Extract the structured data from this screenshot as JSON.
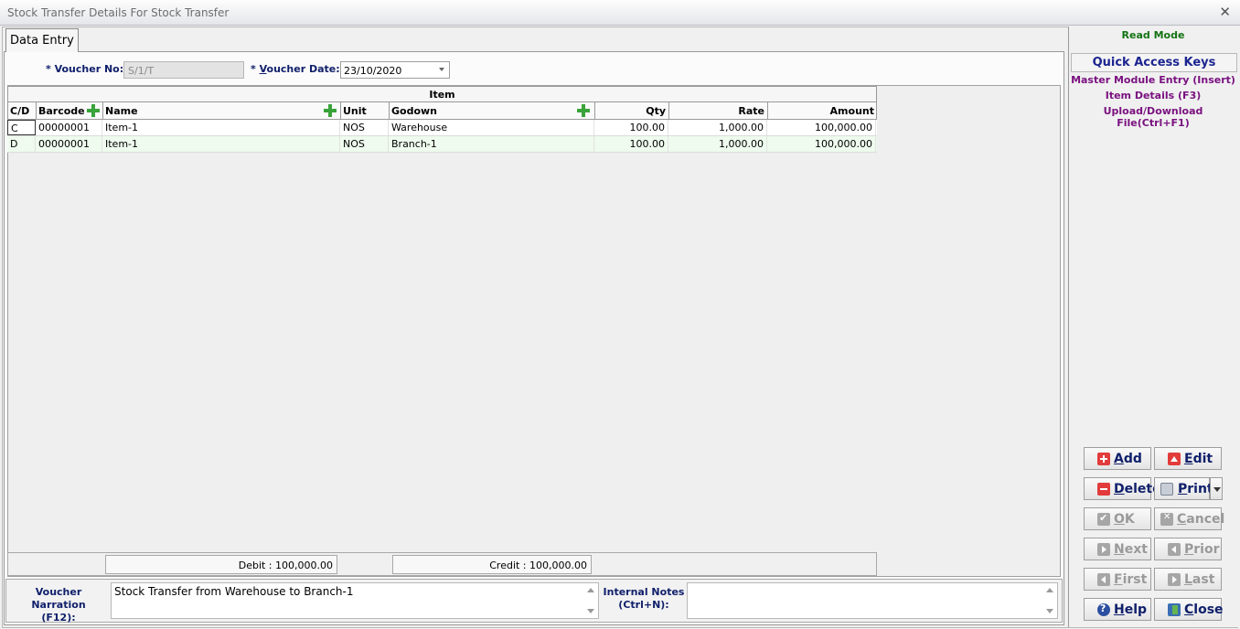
{
  "window": {
    "title": "Stock Transfer Details For Stock Transfer",
    "close_glyph": "✕"
  },
  "tab": {
    "label": "Data Entry"
  },
  "form": {
    "voucher_no_label": "* Voucher No:",
    "voucher_no_value": "S/1/T",
    "voucher_date_label_prefix": "* ",
    "voucher_date_label_underline": "V",
    "voucher_date_label_rest": "oucher Date:",
    "voucher_date_value": "23/10/2020"
  },
  "grid": {
    "group_header": "Item",
    "columns": [
      "C/D",
      "Barcode",
      "Name",
      "Unit",
      "Godown",
      "Qty",
      "Rate",
      "Amount"
    ],
    "rows": [
      [
        "C",
        "00000001",
        "Item-1",
        "NOS",
        "Warehouse",
        "100.00",
        "1,000.00",
        "100,000.00"
      ],
      [
        "D",
        "00000001",
        "Item-1",
        "NOS",
        "Branch-1",
        "100.00",
        "1,000.00",
        "100,000.00"
      ]
    ],
    "debit_total": "Debit : 100,000.00",
    "credit_total": "Credit : 100,000.00"
  },
  "narration": {
    "label_line1": "Voucher Narration",
    "label_line2": "(F12):",
    "value": "Stock Transfer from Warehouse to Branch-1"
  },
  "internal_notes": {
    "label_line1": "Internal Notes",
    "label_line2": "(Ctrl+N):",
    "value": ""
  },
  "sidebar": {
    "mode": "Read Mode",
    "quick_access_title": "Quick Access Keys",
    "quick_access_items": [
      "Master Module Entry (Insert)",
      "Item Details (F3)",
      "Upload/Download File(Ctrl+F1)"
    ]
  },
  "buttons": {
    "add": {
      "u": "A",
      "rest": "dd"
    },
    "edit": {
      "u": "E",
      "rest": "dit"
    },
    "delete": {
      "u": "D",
      "rest": "elete"
    },
    "print": {
      "u": "P",
      "rest": "rint"
    },
    "ok": {
      "u": "O",
      "rest": "K"
    },
    "cancel": {
      "u": "C",
      "rest": "ancel"
    },
    "next": {
      "u": "N",
      "rest": "ext"
    },
    "prior": {
      "u": "P",
      "rest": "rior"
    },
    "first": {
      "u": "F",
      "rest": "irst"
    },
    "last": {
      "u": "L",
      "rest": "ast"
    },
    "help": {
      "u": "H",
      "rest": "elp"
    },
    "close": {
      "u": "C",
      "rest": "lose"
    }
  },
  "colors": {
    "read_mode": "#137213",
    "quick_access": "#7a1280",
    "label": "#10206b",
    "accent_red": "#e23b3b",
    "plus_green": "#3aa33a"
  }
}
